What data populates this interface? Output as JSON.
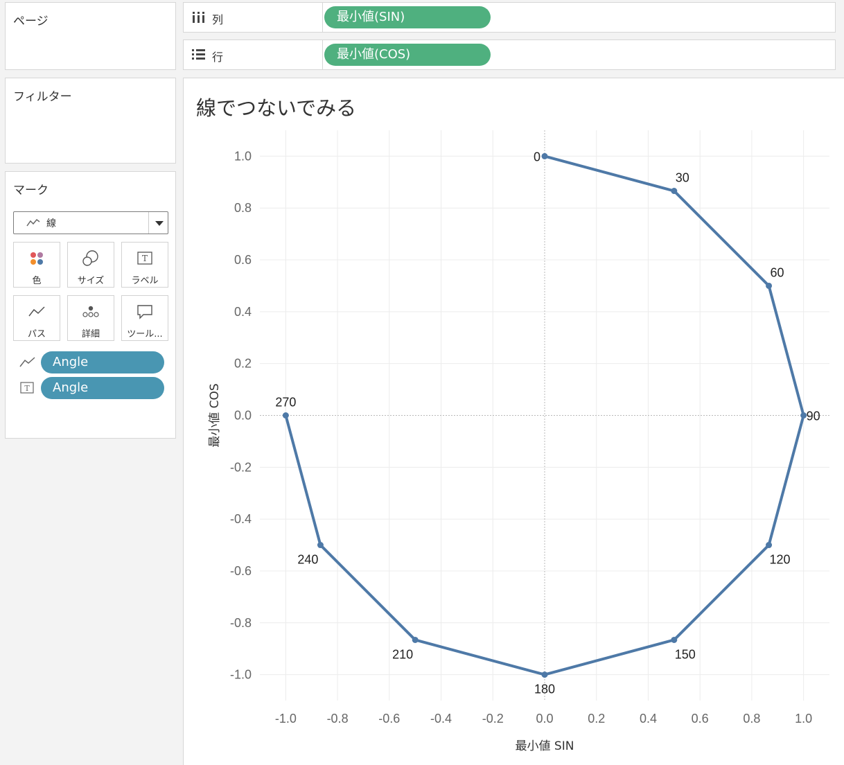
{
  "pages_panel": {
    "title": "ページ"
  },
  "filters_panel": {
    "title": "フィルター"
  },
  "marks_panel": {
    "title": "マーク",
    "mark_type": "線",
    "buttons": [
      {
        "label": "色",
        "icon": "color-icon"
      },
      {
        "label": "サイズ",
        "icon": "size-icon"
      },
      {
        "label": "ラベル",
        "icon": "label-icon"
      },
      {
        "label": "パス",
        "icon": "path-icon"
      },
      {
        "label": "詳細",
        "icon": "detail-icon"
      },
      {
        "label": "ツール...",
        "icon": "tooltip-icon"
      }
    ],
    "fields": [
      {
        "label": "Angle",
        "icon": "path-icon"
      },
      {
        "label": "Angle",
        "icon": "label-icon"
      }
    ]
  },
  "columns_shelf": {
    "label": "列",
    "pill": "最小値(SIN)"
  },
  "rows_shelf": {
    "label": "行",
    "pill": "最小値(COS)"
  },
  "sheet": {
    "title": "線でつないでみる"
  },
  "colors": {
    "line": "#4e79a7",
    "measure_pill": "#4fb07f",
    "dimension_pill": "#4996b2"
  },
  "chart_data": {
    "type": "line",
    "xlabel": "最小値 SIN",
    "ylabel": "最小値 COS",
    "xlim": [
      -1.1,
      1.1
    ],
    "ylim": [
      -1.1,
      1.1
    ],
    "xticks": [
      "-1.0",
      "-0.8",
      "-0.6",
      "-0.4",
      "-0.2",
      "0.0",
      "0.2",
      "0.4",
      "0.6",
      "0.8",
      "1.0"
    ],
    "yticks": [
      "1.0",
      "0.8",
      "0.6",
      "0.4",
      "0.2",
      "0.0",
      "-0.2",
      "-0.4",
      "-0.6",
      "-0.8",
      "-1.0"
    ],
    "grid": true,
    "points": [
      {
        "label": "0",
        "x": 0,
        "y": 1
      },
      {
        "label": "30",
        "x": 0.5,
        "y": 0.866
      },
      {
        "label": "60",
        "x": 0.866,
        "y": 0.5
      },
      {
        "label": "90",
        "x": 1,
        "y": 0
      },
      {
        "label": "120",
        "x": 0.866,
        "y": -0.5
      },
      {
        "label": "150",
        "x": 0.5,
        "y": -0.866
      },
      {
        "label": "180",
        "x": 0,
        "y": -1
      },
      {
        "label": "210",
        "x": -0.5,
        "y": -0.866
      },
      {
        "label": "240",
        "x": -0.866,
        "y": -0.5
      },
      {
        "label": "270",
        "x": -1,
        "y": 0
      }
    ]
  }
}
